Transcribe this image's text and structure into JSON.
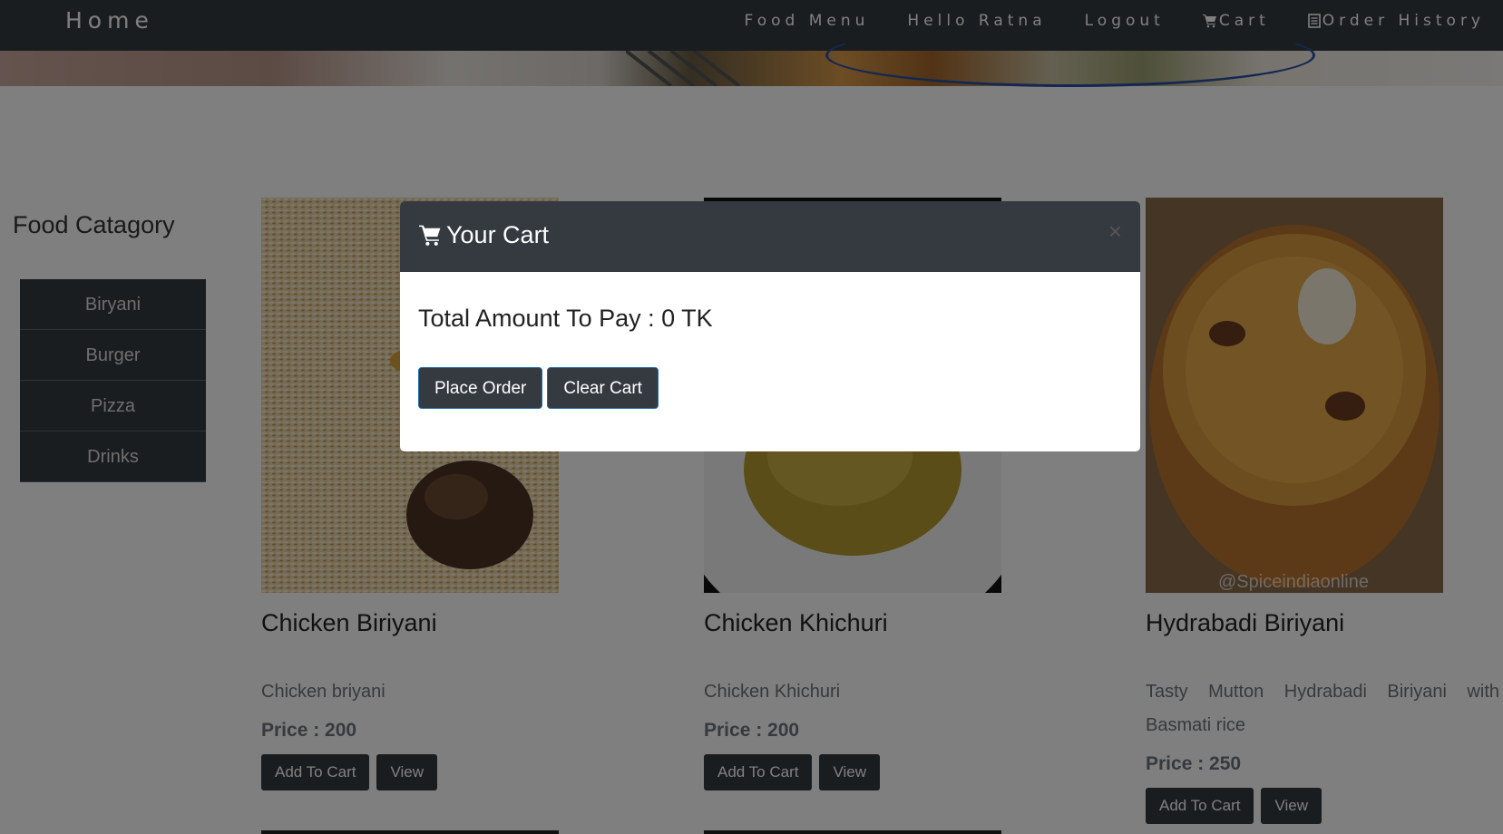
{
  "navbar": {
    "brand": "Home",
    "links": [
      {
        "label": "Food Menu"
      },
      {
        "label": "Hello Ratna"
      },
      {
        "label": "Logout"
      },
      {
        "label": "Cart",
        "icon": "cart-icon"
      },
      {
        "label": "Order History",
        "icon": "receipt-icon"
      }
    ]
  },
  "sidebar": {
    "title": "Food Catagory",
    "categories": [
      "Biryani",
      "Burger",
      "Pizza",
      "Drinks"
    ]
  },
  "cards": [
    {
      "title": "Chicken Biriyani",
      "description": "Chicken briyani",
      "price": "Price : 200",
      "add_label": "Add To Cart",
      "view_label": "View"
    },
    {
      "title": "Chicken Khichuri",
      "description": "Chicken Khichuri",
      "price": "Price : 200",
      "add_label": "Add To Cart",
      "view_label": "View"
    },
    {
      "title": "Hydrabadi Biriyani",
      "description": "Tasty Mutton Hydrabadi Biriyani with Basmati rice",
      "price": "Price : 250",
      "add_label": "Add To Cart",
      "view_label": "View",
      "image_watermark": "@Spiceindiaonline"
    }
  ],
  "modal": {
    "title": "Your Cart",
    "close": "×",
    "total": "Total Amount To Pay : 0 TK",
    "place_order": "Place Order",
    "clear_cart": "Clear Cart"
  },
  "colors": {
    "navbar": "#343a40",
    "overlay": "rgba(0,0,0,0.5)",
    "button": "#343a40"
  }
}
